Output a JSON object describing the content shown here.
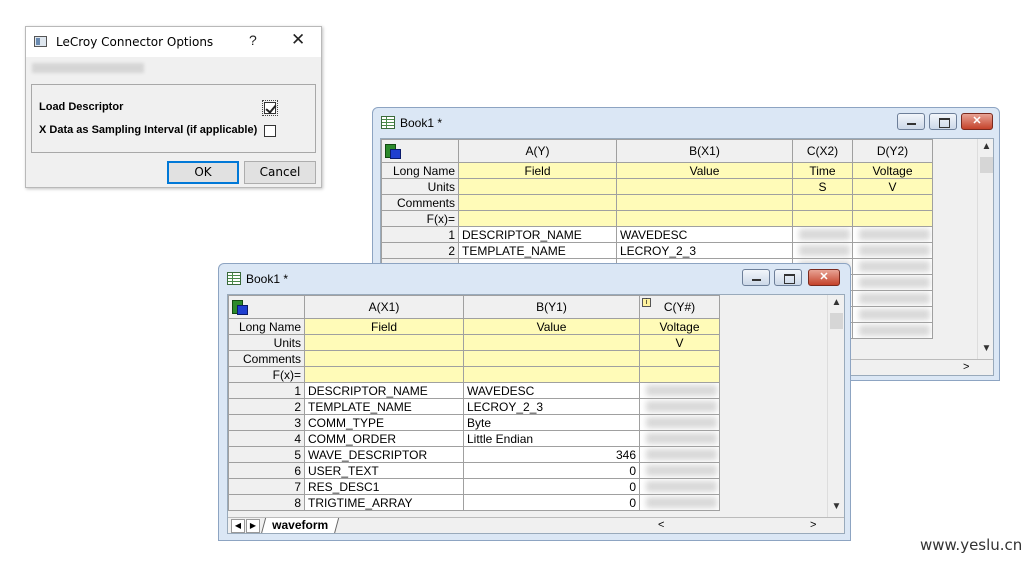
{
  "dialog": {
    "title": "LeCroy Connector Options",
    "help": "?",
    "close": "✕",
    "options": [
      {
        "label": "Load Descriptor",
        "checked": true
      },
      {
        "label": "X Data as Sampling Interval (if applicable)",
        "checked": false
      }
    ],
    "ok_label": "OK",
    "cancel_label": "Cancel"
  },
  "book_back": {
    "title": "Book1 *",
    "columns": [
      "A(Y)",
      "B(X1)",
      "C(X2)",
      "D(Y2)"
    ],
    "meta_rows": [
      {
        "label": "Long Name",
        "values": [
          "Field",
          "Value",
          "Time",
          "Voltage"
        ]
      },
      {
        "label": "Units",
        "values": [
          "",
          "",
          "S",
          "V"
        ]
      },
      {
        "label": "Comments",
        "values": [
          "",
          "",
          "",
          ""
        ]
      },
      {
        "label": "F(x)=",
        "values": [
          "",
          "",
          "",
          ""
        ]
      }
    ],
    "rows": [
      {
        "n": "1",
        "a": "DESCRIPTOR_NAME",
        "b": "WAVEDESC"
      },
      {
        "n": "2",
        "a": "TEMPLATE_NAME",
        "b": "LECROY_2_3"
      }
    ]
  },
  "book_front": {
    "title": "Book1 *",
    "columns": [
      "A(X1)",
      "B(Y1)",
      "C(Y#)"
    ],
    "meta_rows": [
      {
        "label": "Long Name",
        "values": [
          "Field",
          "Value",
          "Voltage"
        ]
      },
      {
        "label": "Units",
        "values": [
          "",
          "",
          "V"
        ]
      },
      {
        "label": "Comments",
        "values": [
          "",
          "",
          ""
        ]
      },
      {
        "label": "F(x)=",
        "values": [
          "",
          "",
          ""
        ]
      }
    ],
    "rows": [
      {
        "n": "1",
        "a": "DESCRIPTOR_NAME",
        "b": "WAVEDESC"
      },
      {
        "n": "2",
        "a": "TEMPLATE_NAME",
        "b": "LECROY_2_3"
      },
      {
        "n": "3",
        "a": "COMM_TYPE",
        "b": "Byte"
      },
      {
        "n": "4",
        "a": "COMM_ORDER",
        "b": "Little Endian"
      },
      {
        "n": "5",
        "a": "WAVE_DESCRIPTOR",
        "b": "346"
      },
      {
        "n": "6",
        "a": "USER_TEXT",
        "b": "0"
      },
      {
        "n": "7",
        "a": "RES_DESC1",
        "b": "0"
      },
      {
        "n": "8",
        "a": "TRIGTIME_ARRAY",
        "b": "0"
      }
    ],
    "sheet_tab": "waveform"
  },
  "icons": {
    "nav_left": "◀",
    "nav_right": "▶",
    "up_arrow": "▲",
    "down_arrow": "▼",
    "h_left": "<",
    "h_right": ">"
  },
  "watermark": "www.yeslu.cn"
}
